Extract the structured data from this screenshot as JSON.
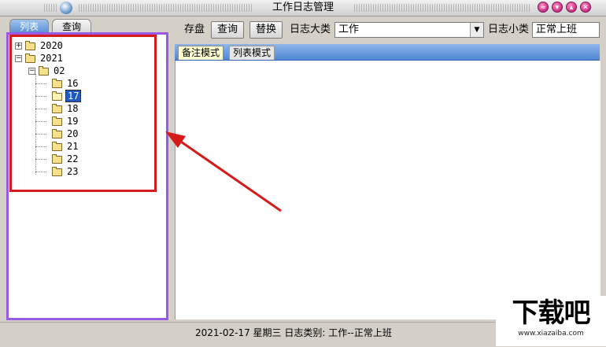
{
  "window": {
    "title": "工作日志管理",
    "buttons": [
      "menu",
      "minimize",
      "maximize",
      "close"
    ],
    "button_color": "#cc2e87"
  },
  "left_tabs": [
    {
      "label": "列表",
      "active": true
    },
    {
      "label": "查询",
      "active": false
    }
  ],
  "tree": {
    "items": [
      {
        "label": "2020",
        "level": 0,
        "expander": "+",
        "folder": "closed"
      },
      {
        "label": "2021",
        "level": 0,
        "expander": "-",
        "folder": "closed"
      },
      {
        "label": "02",
        "level": 1,
        "expander": "-",
        "folder": "closed"
      },
      {
        "label": "16",
        "level": 2,
        "folder": "closed"
      },
      {
        "label": "17",
        "level": 2,
        "folder": "open",
        "selected": true
      },
      {
        "label": "18",
        "level": 2,
        "folder": "closed"
      },
      {
        "label": "19",
        "level": 2,
        "folder": "closed"
      },
      {
        "label": "20",
        "level": 2,
        "folder": "closed"
      },
      {
        "label": "21",
        "level": 2,
        "folder": "closed"
      },
      {
        "label": "22",
        "level": 2,
        "folder": "closed"
      },
      {
        "label": "23",
        "level": 2,
        "folder": "closed"
      }
    ]
  },
  "toolbar": {
    "save_label": "存盘",
    "query_label": "查询",
    "replace_label": "替换",
    "category_label": "日志大类",
    "category_value": "工作",
    "subcategory_label": "日志小类",
    "subcategory_value": "正常上班"
  },
  "mode_tabs": [
    {
      "label": "备注模式",
      "active": true
    },
    {
      "label": "列表模式",
      "active": false
    }
  ],
  "status": {
    "text": "2021-02-17 星期三 日志类别: 工作--正常上班"
  },
  "annotation": {
    "color": "#d61b1b"
  },
  "watermark": {
    "logo": "下载吧",
    "url": "www.xiazaiba.com"
  },
  "colors": {
    "accent_tab": "#5a8ed2",
    "selection": "#1c5bc6",
    "panel_border": "#9a58e6"
  }
}
